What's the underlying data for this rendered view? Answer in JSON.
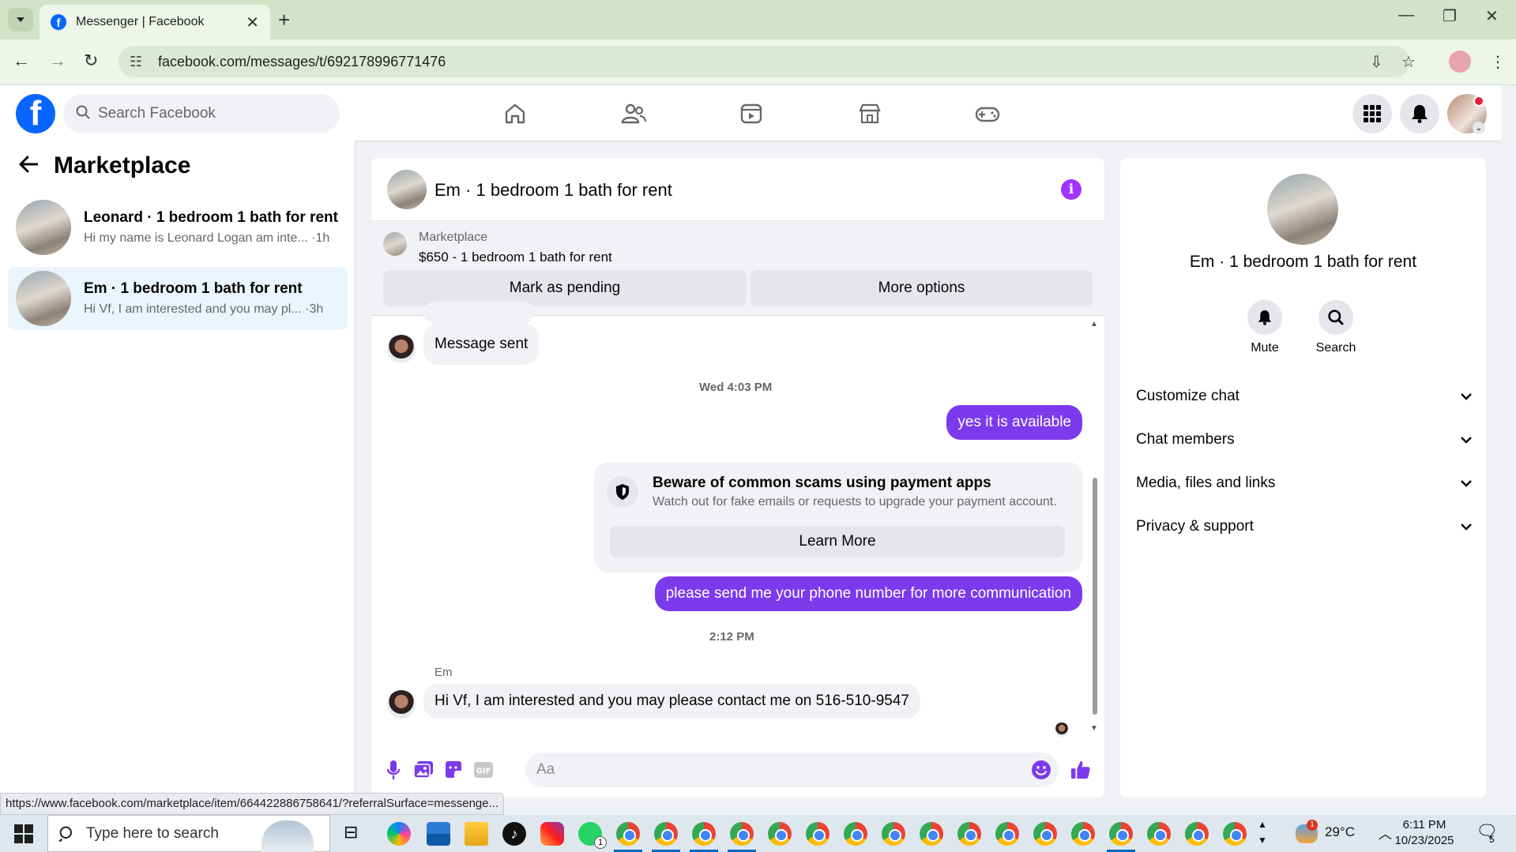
{
  "browser": {
    "tab_title": "Messenger | Facebook",
    "url": "facebook.com/messages/t/692178996771476"
  },
  "fb": {
    "logo": "f",
    "search_placeholder": "Search Facebook",
    "nav_icons": [
      "home-icon",
      "friends-icon",
      "video-icon",
      "marketplace-icon",
      "gaming-icon"
    ]
  },
  "sidebar": {
    "title": "Marketplace",
    "conversations": [
      {
        "title": "Leonard · 1 bedroom 1 bath for rent",
        "preview": "Hi my name is Leonard Logan am inte... ·1h"
      },
      {
        "title": "Em · 1 bedroom 1 bath for rent",
        "preview": "Hi Vf, I am interested and you may pl... ·3h"
      }
    ]
  },
  "chat": {
    "title": "Em · 1 bedroom 1 bath for rent",
    "marketplace_label": "Marketplace",
    "listing": "$650 - 1 bedroom 1 bath for rent",
    "mark_pending": "Mark as pending",
    "more_options": "More options",
    "messages": {
      "sent_notice": "Message sent",
      "ts1": "Wed 4:03 PM",
      "out1": "yes it is available",
      "scam_title": "Beware of common scams using payment apps",
      "scam_sub": "Watch out for fake emails or requests to upgrade your payment account.",
      "learn_more": "Learn More",
      "out2": "please send me your phone number for more communication",
      "ts2": "2:12 PM",
      "sender": "Em",
      "in1": "Hi Vf, I am interested and you may please contact me on 516-510-9547"
    },
    "composer_placeholder": "Aa",
    "accent": "#7c3aed"
  },
  "info": {
    "title": "Em · 1 bedroom 1 bath for rent",
    "mute": "Mute",
    "search": "Search",
    "rows": [
      "Customize chat",
      "Chat members",
      "Media, files and links",
      "Privacy & support"
    ]
  },
  "status_url": "https://www.facebook.com/marketplace/item/664422886758641/?referralSurface=messenge...",
  "taskbar": {
    "search_placeholder": "Type here to search",
    "whatsapp_badge": "1",
    "weather_badge": "1",
    "temp": "29°C",
    "time": "6:11 PM",
    "date": "10/23/2025",
    "notif_count": "5"
  }
}
